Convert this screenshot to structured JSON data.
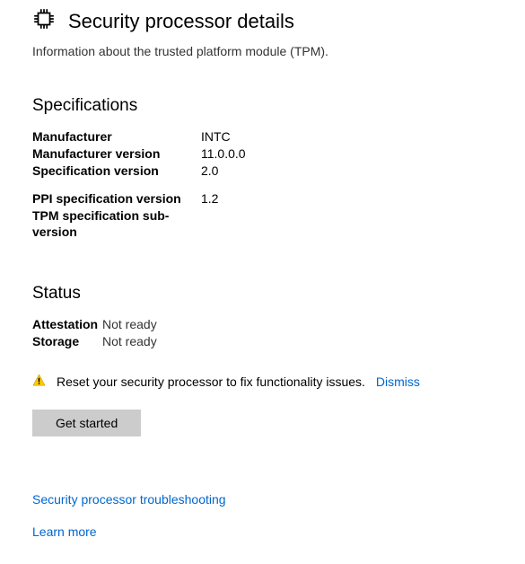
{
  "header": {
    "title": "Security processor details",
    "subtitle": "Information about the trusted platform module (TPM)."
  },
  "specifications": {
    "heading": "Specifications",
    "group1": [
      {
        "label": "Manufacturer",
        "value": "INTC"
      },
      {
        "label": "Manufacturer version",
        "value": "11.0.0.0"
      },
      {
        "label": "Specification version",
        "value": "2.0"
      }
    ],
    "group2": [
      {
        "label": "PPI specification version",
        "value": "1.2"
      },
      {
        "label": "TPM specification sub-version",
        "value": ""
      }
    ]
  },
  "status": {
    "heading": "Status",
    "rows": [
      {
        "label": "Attestation",
        "value": "Not ready"
      },
      {
        "label": "Storage",
        "value": "Not ready"
      }
    ],
    "alert": {
      "text": "Reset your security processor to fix functionality issues.",
      "dismiss_label": "Dismiss"
    },
    "button_label": "Get started"
  },
  "links": {
    "troubleshooting": "Security processor troubleshooting",
    "learn_more": "Learn more"
  }
}
